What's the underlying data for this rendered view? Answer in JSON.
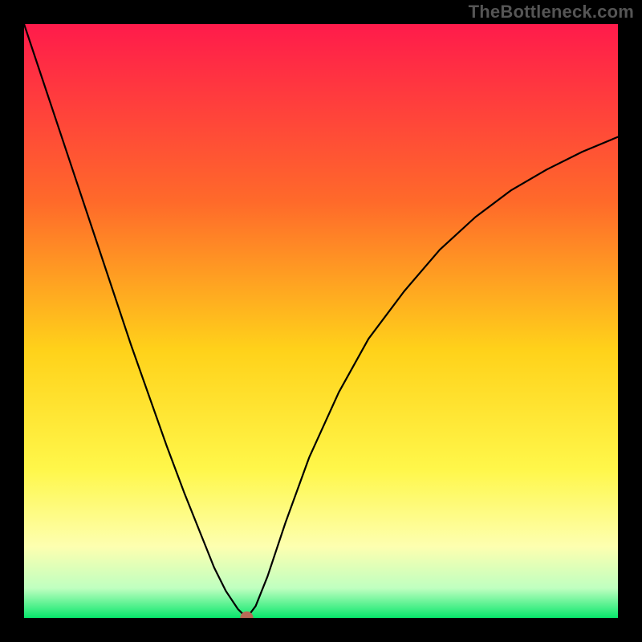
{
  "watermark": "TheBottleneck.com",
  "chart_data": {
    "type": "line",
    "title": "",
    "xlabel": "",
    "ylabel": "",
    "xlim": [
      0,
      100
    ],
    "ylim": [
      0,
      100
    ],
    "gradient_stops": [
      {
        "offset": 0,
        "color": "#ff1b4b"
      },
      {
        "offset": 30,
        "color": "#ff6a2a"
      },
      {
        "offset": 55,
        "color": "#ffd21a"
      },
      {
        "offset": 75,
        "color": "#fff74a"
      },
      {
        "offset": 88,
        "color": "#fdffb0"
      },
      {
        "offset": 95,
        "color": "#bfffc0"
      },
      {
        "offset": 100,
        "color": "#08e76b"
      }
    ],
    "series": [
      {
        "name": "bottleneck-curve",
        "x": [
          0,
          3,
          6,
          9,
          12,
          15,
          18,
          21,
          24,
          27,
          30,
          32,
          34,
          36,
          37.5,
          39,
          41,
          44,
          48,
          53,
          58,
          64,
          70,
          76,
          82,
          88,
          94,
          100
        ],
        "y": [
          100,
          91,
          82,
          73,
          64,
          55,
          46,
          37.5,
          29,
          21,
          13.5,
          8.5,
          4.5,
          1.5,
          0,
          2,
          7,
          16,
          27,
          38,
          47,
          55,
          62,
          67.5,
          72,
          75.5,
          78.5,
          81
        ]
      }
    ],
    "marker": {
      "x": 37.5,
      "y": 0,
      "color": "#b86a57",
      "r": 1.1
    }
  }
}
